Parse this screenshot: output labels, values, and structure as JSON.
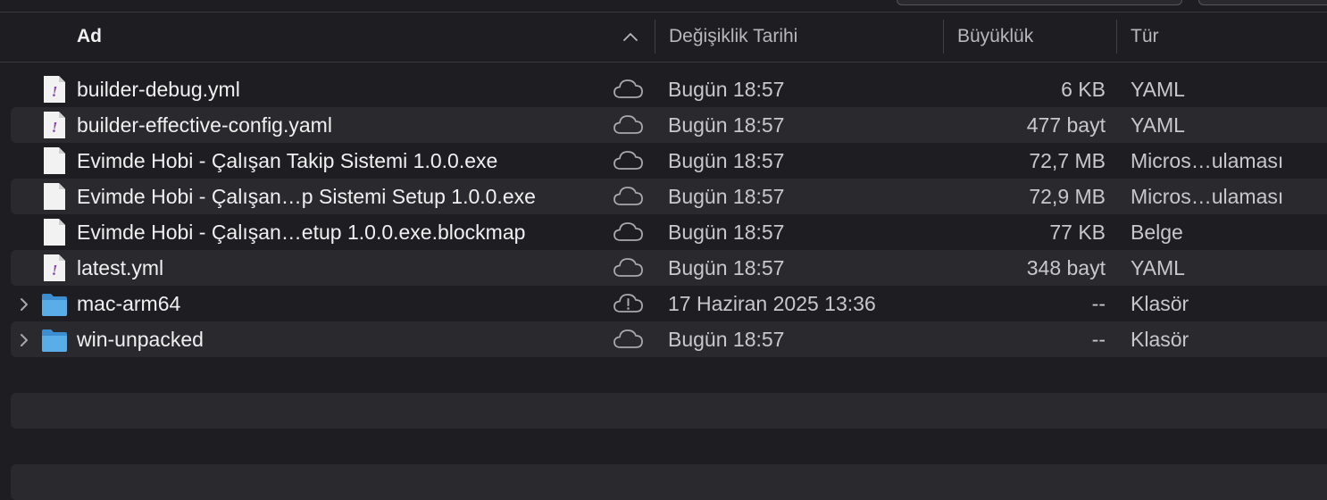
{
  "header": {
    "name": "Ad",
    "date": "Değişiklik Tarihi",
    "size": "Büyüklük",
    "kind": "Tür"
  },
  "files": [
    {
      "name": "builder-debug.yml",
      "date": "Bugün 18:57",
      "size": "6 KB",
      "kind": "YAML",
      "icon": "yaml-file-icon",
      "cloud": "cloud-icon"
    },
    {
      "name": "builder-effective-config.yaml",
      "date": "Bugün 18:57",
      "size": "477 bayt",
      "kind": "YAML",
      "icon": "yaml-file-icon",
      "cloud": "cloud-icon"
    },
    {
      "name": "Evimde Hobi - Çalışan Takip Sistemi 1.0.0.exe",
      "date": "Bugün 18:57",
      "size": "72,7 MB",
      "kind": "Micros…ulaması",
      "icon": "document-icon",
      "cloud": "cloud-icon"
    },
    {
      "name": "Evimde Hobi - Çalışan…p Sistemi Setup 1.0.0.exe",
      "date": "Bugün 18:57",
      "size": "72,9 MB",
      "kind": "Micros…ulaması",
      "icon": "document-icon",
      "cloud": "cloud-icon"
    },
    {
      "name": "Evimde Hobi - Çalışan…etup 1.0.0.exe.blockmap",
      "date": "Bugün 18:57",
      "size": "77 KB",
      "kind": "Belge",
      "icon": "document-icon",
      "cloud": "cloud-icon"
    },
    {
      "name": "latest.yml",
      "date": "Bugün 18:57",
      "size": "348 bayt",
      "kind": "YAML",
      "icon": "yaml-file-icon",
      "cloud": "cloud-icon"
    },
    {
      "name": "mac-arm64",
      "date": "17 Haziran 2025 13:36",
      "size": "--",
      "kind": "Klasör",
      "icon": "folder-icon",
      "cloud": "cloud-alert-icon"
    },
    {
      "name": "win-unpacked",
      "date": "Bugün 18:57",
      "size": "--",
      "kind": "Klasör",
      "icon": "folder-icon",
      "cloud": "cloud-icon"
    }
  ],
  "colors": {
    "background": "#1e1e22",
    "alt_row": "#2a2a2e",
    "folder": "#5aaee8",
    "yaml_mark": "#8e44ad"
  }
}
